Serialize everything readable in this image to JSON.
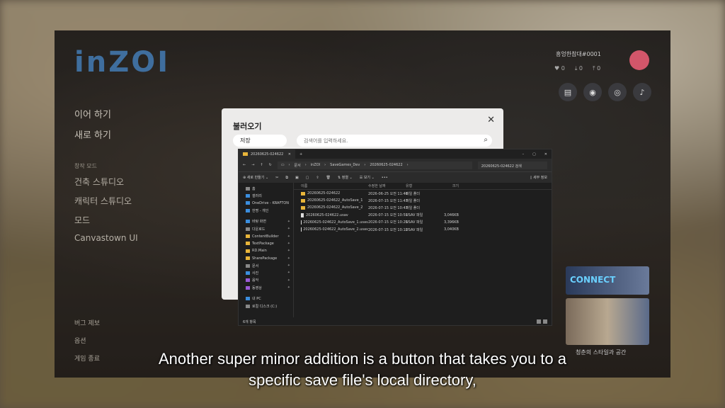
{
  "game": {
    "logo": "inZOI",
    "menu": {
      "continue": "이어 하기",
      "new_game": "새로 하기",
      "section_label": "창작 모드",
      "build_studio": "건축 스튜디오",
      "character_studio": "캐릭터 스튜디오",
      "mods": "모드",
      "canvastown": "Canvastown UI"
    },
    "bottom_menu": {
      "bug_report": "버그 제보",
      "options": "옵션",
      "quit": "게임 종료"
    },
    "profile": {
      "name": "흥엉한참대#0001",
      "stats": [
        "0",
        "0",
        "0"
      ]
    },
    "promo": {
      "banner_text": "CONNECT",
      "caption": "청춘의 스타일과 공간"
    }
  },
  "dialog": {
    "title": "불러오기",
    "close": "✕",
    "tab_label": "저장",
    "search_placeholder": "검색어를 입력하세요."
  },
  "explorer": {
    "tab_title": "20260625-024622",
    "new_tab": "+",
    "window_buttons": [
      "–",
      "▢",
      "✕"
    ],
    "breadcrumb": [
      "문서",
      "inZOI",
      "SaveGames_Dev",
      "20260625-024622"
    ],
    "search_placeholder": "20260625-024622 검색",
    "toolbar": {
      "new": "새로 만들기",
      "sort": "정렬",
      "view": "보기",
      "more": "•••",
      "details": "세부 정보"
    },
    "sidebar": [
      {
        "label": "홈",
        "icon": "grey",
        "pin": false
      },
      {
        "label": "갤러리",
        "icon": "blue",
        "pin": false
      },
      {
        "label": "OneDrive - KRAFTON",
        "icon": "blue",
        "pin": false
      },
      {
        "label": "한명 - 개인",
        "icon": "blue",
        "pin": false
      },
      {
        "label": "",
        "icon": "",
        "pin": false
      },
      {
        "label": "바탕 화면",
        "icon": "blue",
        "pin": true
      },
      {
        "label": "다운로드",
        "icon": "grey",
        "pin": true
      },
      {
        "label": "ContentBuilder",
        "icon": "",
        "pin": true
      },
      {
        "label": "TextPackage",
        "icon": "",
        "pin": true
      },
      {
        "label": "RD.Main",
        "icon": "",
        "pin": true
      },
      {
        "label": "SharePackage",
        "icon": "",
        "pin": true
      },
      {
        "label": "문서",
        "icon": "grey",
        "pin": true
      },
      {
        "label": "사진",
        "icon": "blue",
        "pin": true
      },
      {
        "label": "음악",
        "icon": "purple",
        "pin": true
      },
      {
        "label": "동영상",
        "icon": "purple",
        "pin": true
      },
      {
        "label": "",
        "icon": "",
        "pin": false
      },
      {
        "label": "내 PC",
        "icon": "blue",
        "pin": false
      },
      {
        "label": "로컬 디스크 (C:)",
        "icon": "grey",
        "pin": false
      }
    ],
    "columns": [
      "이름",
      "수정한 날짜",
      "유형",
      "크기"
    ],
    "rows": [
      {
        "name": "20260625-024622",
        "date": "2026-06-25 오전 11:46",
        "type": "파일 폴더",
        "size": "",
        "folder": true
      },
      {
        "name": "20260625-024622_AutoSave_1",
        "date": "2026-07-15 오전 11:47",
        "type": "파일 폴더",
        "size": "",
        "folder": true
      },
      {
        "name": "20260625-024622_AutoSave_2",
        "date": "2026-07-15 오전 10:47",
        "type": "파일 폴더",
        "size": "",
        "folder": true
      },
      {
        "name": "20260625-024622.usav",
        "date": "2026-07-15 오전 10:51",
        "type": "USAV 파일",
        "size": "3,046KB",
        "folder": false
      },
      {
        "name": "20260625-024622_AutoSave_1.usav",
        "date": "2026-07-15 오전 10:25",
        "type": "USAV 파일",
        "size": "3,396KB",
        "folder": false
      },
      {
        "name": "20260625-024622_AutoSave_2.usav",
        "date": "2026-07-15 오전 10:12",
        "type": "USAV 파일",
        "size": "3,040KB",
        "folder": false
      }
    ],
    "status": "6개 항목"
  },
  "subtitle": {
    "line1": "Another super minor addition is a button that takes you to a",
    "line2": "specific save file's local directory,"
  }
}
